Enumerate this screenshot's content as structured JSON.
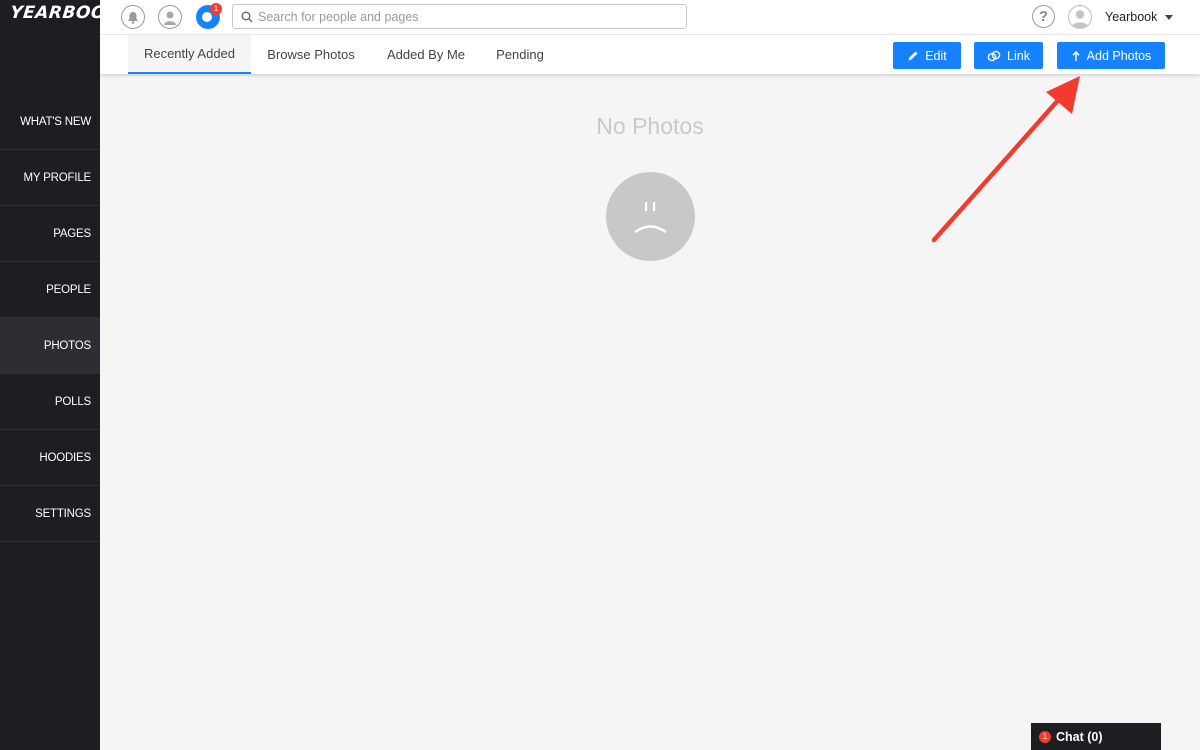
{
  "app": {
    "logo_text": "YEARBOOK"
  },
  "sidebar": {
    "items": [
      {
        "label": "WHAT'S NEW"
      },
      {
        "label": "MY PROFILE"
      },
      {
        "label": "PAGES"
      },
      {
        "label": "PEOPLE"
      },
      {
        "label": "PHOTOS",
        "active": true
      },
      {
        "label": "POLLS"
      },
      {
        "label": "HOODIES"
      },
      {
        "label": "SETTINGS"
      }
    ]
  },
  "topbar": {
    "icons": [
      "bell-icon",
      "profile-icon",
      "messages-icon"
    ],
    "messages_badge": "1",
    "search": {
      "placeholder": "Search for people and pages",
      "value": ""
    },
    "help_icon": "?",
    "user_name": "Yearbook"
  },
  "tabs": [
    {
      "label": "Recently Added",
      "active": true
    },
    {
      "label": "Browse Photos"
    },
    {
      "label": "Added By Me"
    },
    {
      "label": "Pending"
    }
  ],
  "actions": {
    "edit_label": "Edit",
    "link_label": "Link",
    "add_photos_label": "Add Photos"
  },
  "empty_state": {
    "title": "No Photos"
  },
  "chat": {
    "badge": "1",
    "label": "Chat (0)"
  },
  "colors": {
    "accent": "#1782ff",
    "sidebar_bg": "#1c1e22",
    "badge_red": "#f23c2e",
    "annotation_arrow": "#f23a2e"
  }
}
